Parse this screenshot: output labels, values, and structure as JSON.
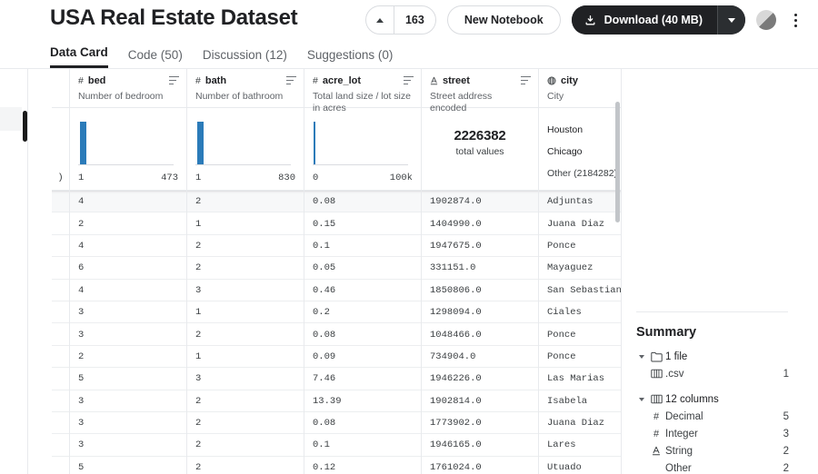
{
  "header": {
    "title": "USA Real Estate Dataset",
    "vote_count": "163",
    "vote_up_icon": "caret-up-icon",
    "new_notebook_label": "New Notebook",
    "download_label": "Download (40 MB)",
    "download_icon": "download-icon",
    "download_caret_icon": "caret-down-icon",
    "avatar_icon": "avatar",
    "more_icon": "kebab-menu-icon"
  },
  "tabs": [
    {
      "label": "Data Card",
      "active": true
    },
    {
      "label": "Code (50)",
      "active": false
    },
    {
      "label": "Discussion (12)",
      "active": false
    },
    {
      "label": "Suggestions (0)",
      "active": false
    }
  ],
  "table": {
    "columns": [
      {
        "name": "bed",
        "type_icon": "hash-icon",
        "type_glyph": "#",
        "description": "Number of bedroom",
        "sort_icon": "sort-icon",
        "summary": {
          "kind": "histogram",
          "axis_min": "1",
          "axis_max": "473",
          "bars": [
            {
              "left_pct": 2,
              "height_pct": 100,
              "width": "thick"
            }
          ]
        }
      },
      {
        "name": "bath",
        "type_icon": "hash-icon",
        "type_glyph": "#",
        "description": "Number of bathroom",
        "sort_icon": "sort-icon",
        "summary": {
          "kind": "histogram",
          "axis_min": "1",
          "axis_max": "830",
          "bars": [
            {
              "left_pct": 2,
              "height_pct": 100,
              "width": "thick"
            }
          ]
        }
      },
      {
        "name": "acre_lot",
        "type_icon": "hash-icon",
        "type_glyph": "#",
        "description": "Total land size / lot size in acres",
        "sort_icon": "sort-icon",
        "summary": {
          "kind": "histogram",
          "axis_min": "0",
          "axis_max": "100k",
          "bars": [
            {
              "left_pct": 1,
              "height_pct": 100,
              "width": "thin"
            }
          ]
        }
      },
      {
        "name": "street",
        "type_icon": "string-icon",
        "type_glyph": "A",
        "description": "Street address encoded",
        "sort_icon": "sort-icon",
        "summary": {
          "kind": "total",
          "total_value": "2226382",
          "total_label": "total values"
        }
      },
      {
        "name": "city",
        "type_icon": "globe-icon",
        "type_glyph": "globe",
        "description": "City",
        "sort_icon": null,
        "summary": {
          "kind": "categories",
          "items": [
            "Houston",
            "Chicago",
            "Other (2184282)"
          ]
        }
      }
    ],
    "rows": [
      {
        "bed": "4",
        "bath": "2",
        "acre_lot": "0.08",
        "street": "1902874.0",
        "city": "Adjuntas"
      },
      {
        "bed": "2",
        "bath": "1",
        "acre_lot": "0.15",
        "street": "1404990.0",
        "city": "Juana Diaz"
      },
      {
        "bed": "4",
        "bath": "2",
        "acre_lot": "0.1",
        "street": "1947675.0",
        "city": "Ponce"
      },
      {
        "bed": "6",
        "bath": "2",
        "acre_lot": "0.05",
        "street": "331151.0",
        "city": "Mayaguez"
      },
      {
        "bed": "4",
        "bath": "3",
        "acre_lot": "0.46",
        "street": "1850806.0",
        "city": "San Sebastian"
      },
      {
        "bed": "3",
        "bath": "1",
        "acre_lot": "0.2",
        "street": "1298094.0",
        "city": "Ciales"
      },
      {
        "bed": "3",
        "bath": "2",
        "acre_lot": "0.08",
        "street": "1048466.0",
        "city": "Ponce"
      },
      {
        "bed": "2",
        "bath": "1",
        "acre_lot": "0.09",
        "street": "734904.0",
        "city": "Ponce"
      },
      {
        "bed": "5",
        "bath": "3",
        "acre_lot": "7.46",
        "street": "1946226.0",
        "city": "Las Marias"
      },
      {
        "bed": "3",
        "bath": "2",
        "acre_lot": "13.39",
        "street": "1902814.0",
        "city": "Isabela"
      },
      {
        "bed": "3",
        "bath": "2",
        "acre_lot": "0.08",
        "street": "1773902.0",
        "city": "Juana Diaz"
      },
      {
        "bed": "3",
        "bath": "2",
        "acre_lot": "0.1",
        "street": "1946165.0",
        "city": "Lares"
      },
      {
        "bed": "5",
        "bath": "2",
        "acre_lot": "0.12",
        "street": "1761024.0",
        "city": "Utuado"
      }
    ]
  },
  "summary_panel": {
    "title": "Summary",
    "groups": [
      {
        "twisty_icon": "caret-down-icon",
        "icon": "folder-icon",
        "label": "1 file",
        "count": "",
        "children": [
          {
            "icon": "table-icon",
            "label": ".csv",
            "count": "1"
          }
        ]
      },
      {
        "twisty_icon": "caret-down-icon",
        "icon": "table-icon",
        "label": "12 columns",
        "count": "",
        "children": [
          {
            "icon": "hash-icon",
            "label": "Decimal",
            "count": "5"
          },
          {
            "icon": "hash-icon",
            "label": "Integer",
            "count": "3"
          },
          {
            "icon": "string-icon",
            "label": "String",
            "count": "2"
          },
          {
            "icon": "none",
            "label": "Other",
            "count": "2"
          }
        ]
      }
    ]
  },
  "colors": {
    "bar": "#2b7bb9",
    "accent_dark": "#202124",
    "border": "#e8eaed"
  }
}
